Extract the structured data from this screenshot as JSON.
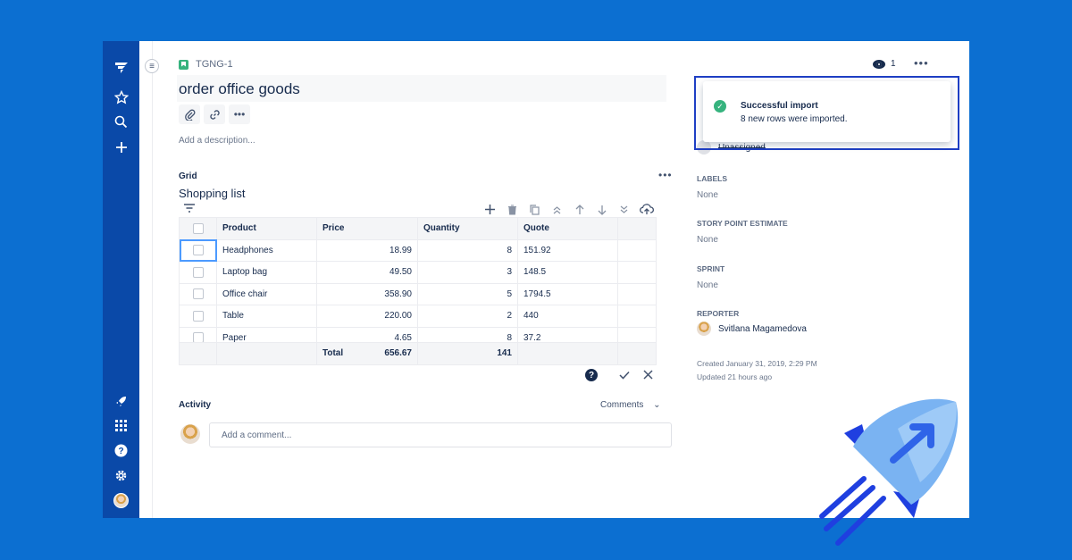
{
  "nav": {
    "icons": [
      "jira-logo-icon",
      "star-icon",
      "search-icon",
      "plus-icon",
      "rocket-nav-icon",
      "apps-grid-icon",
      "help-icon",
      "gear-icon",
      "avatar"
    ]
  },
  "issue": {
    "key": "TGNG-1",
    "title": "order office goods",
    "description_placeholder": "Add a description..."
  },
  "grid": {
    "label": "Grid",
    "more": "•••",
    "name": "Shopping list",
    "columns": [
      "Product",
      "Price",
      "Quantity",
      "Quote"
    ],
    "rows": [
      {
        "product": "Headphones",
        "price": "18.99",
        "quantity": "8",
        "quote": "151.92"
      },
      {
        "product": "Laptop bag",
        "price": "49.50",
        "quantity": "3",
        "quote": "148.5"
      },
      {
        "product": "Office chair",
        "price": "358.90",
        "quantity": "5",
        "quote": "1794.5"
      },
      {
        "product": "Table",
        "price": "220.00",
        "quantity": "2",
        "quote": "440"
      },
      {
        "product": "Paper",
        "price": "4.65",
        "quantity": "8",
        "quote": "37.2"
      }
    ],
    "total": {
      "label": "Total",
      "price": "656.67",
      "quantity": "141"
    }
  },
  "activity": {
    "label": "Activity",
    "filter": "Comments",
    "comment_placeholder": "Add a comment..."
  },
  "watch": {
    "count": "1"
  },
  "top_more": "•••",
  "sidebar": {
    "assignee": "Unassigned",
    "labels_label": "LABELS",
    "labels_value": "None",
    "story_points_label": "STORY POINT ESTIMATE",
    "story_points_value": "None",
    "sprint_label": "SPRINT",
    "sprint_value": "None",
    "reporter_label": "REPORTER",
    "reporter_name": "Svitlana Magamedova",
    "created": "Created January 31, 2019, 2:29 PM",
    "updated": "Updated 21 hours ago"
  },
  "toast": {
    "title": "Successful import",
    "body": "8 new rows were imported."
  },
  "colors": {
    "background": "#0c6fd1",
    "nav": "#0a49a8",
    "success": "#36b37e",
    "toast_border": "#1f3fc4"
  }
}
